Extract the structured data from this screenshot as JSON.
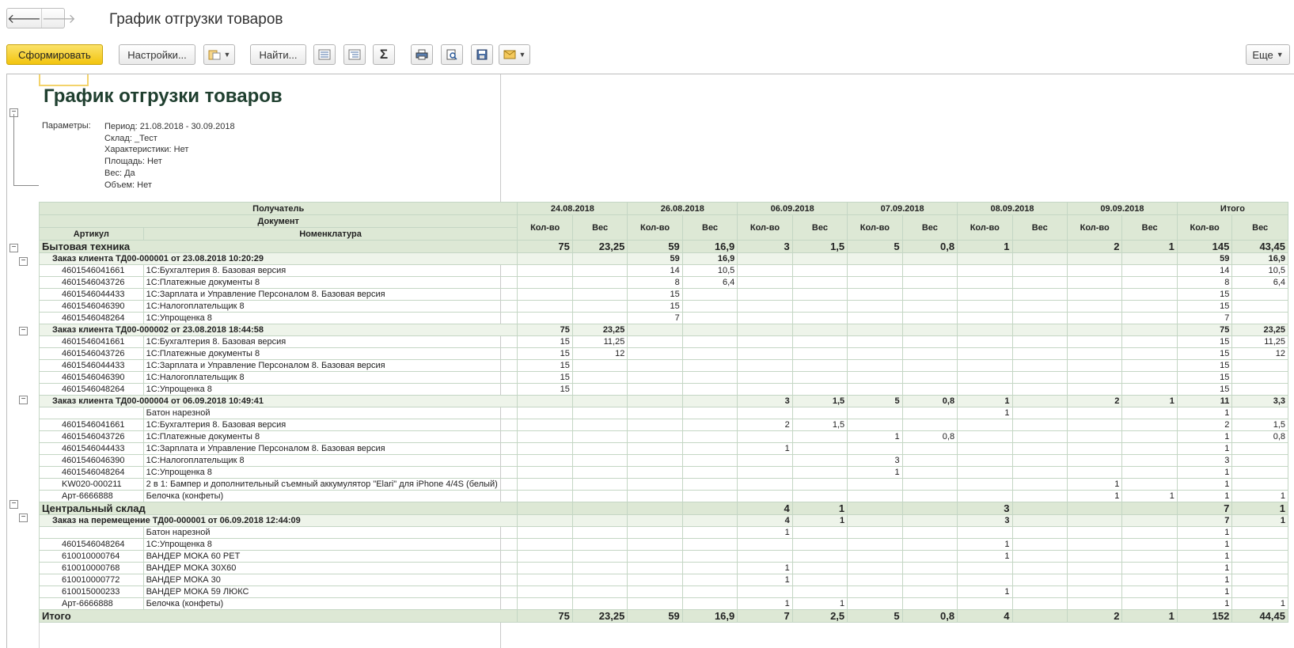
{
  "window": {
    "title": "График отгрузки товаров"
  },
  "nav": {
    "back_icon": "arrow-left-icon",
    "forward_icon": "arrow-right-icon"
  },
  "toolbar": {
    "generate": "Сформировать",
    "settings": "Настройки...",
    "find": "Найти...",
    "more": "Еще"
  },
  "report": {
    "title": "График отгрузки товаров",
    "params_label": "Параметры:",
    "params": [
      "Период: 21.08.2018 - 30.09.2018",
      "Склад: _Тест",
      "Характеристики: Нет",
      "Площадь: Нет",
      "Вес: Да",
      "Объем: Нет"
    ],
    "header": {
      "recipient": "Получатель",
      "document": "Документ",
      "article": "Артикул",
      "nomenclature": "Номенклатура",
      "dates": [
        "24.08.2018",
        "26.08.2018",
        "06.09.2018",
        "07.09.2018",
        "08.09.2018",
        "09.09.2018",
        "Итого"
      ],
      "qty": "Кол-во",
      "weight": "Вес"
    },
    "rows": [
      {
        "level": 1,
        "name": "Бытовая техника",
        "v": [
          "75",
          "23,25",
          "59",
          "16,9",
          "3",
          "1,5",
          "5",
          "0,8",
          "1",
          "",
          "2",
          "1",
          "145",
          "43,45"
        ]
      },
      {
        "level": 2,
        "name": "Заказ клиента ТД00-000001 от 23.08.2018 10:20:29",
        "v": [
          "",
          "",
          "59",
          "16,9",
          "",
          "",
          "",
          "",
          "",
          "",
          "",
          "",
          "59",
          "16,9"
        ]
      },
      {
        "level": 3,
        "art": "4601546041661",
        "name": "1С:Бухгалтерия 8. Базовая версия",
        "v": [
          "",
          "",
          "14",
          "10,5",
          "",
          "",
          "",
          "",
          "",
          "",
          "",
          "",
          "14",
          "10,5"
        ]
      },
      {
        "level": 3,
        "art": "4601546043726",
        "name": "1С:Платежные документы 8",
        "v": [
          "",
          "",
          "8",
          "6,4",
          "",
          "",
          "",
          "",
          "",
          "",
          "",
          "",
          "8",
          "6,4"
        ]
      },
      {
        "level": 3,
        "art": "4601546044433",
        "name": "1С:Зарплата и Управление Персоналом 8. Базовая версия",
        "v": [
          "",
          "",
          "15",
          "",
          "",
          "",
          "",
          "",
          "",
          "",
          "",
          "",
          "15",
          ""
        ]
      },
      {
        "level": 3,
        "art": "4601546046390",
        "name": "1С:Налогоплательщик 8",
        "v": [
          "",
          "",
          "15",
          "",
          "",
          "",
          "",
          "",
          "",
          "",
          "",
          "",
          "15",
          ""
        ]
      },
      {
        "level": 3,
        "art": "4601546048264",
        "name": "1С:Упрощенка 8",
        "v": [
          "",
          "",
          "7",
          "",
          "",
          "",
          "",
          "",
          "",
          "",
          "",
          "",
          "7",
          ""
        ]
      },
      {
        "level": 2,
        "name": "Заказ клиента ТД00-000002 от 23.08.2018 18:44:58",
        "v": [
          "75",
          "23,25",
          "",
          "",
          "",
          "",
          "",
          "",
          "",
          "",
          "",
          "",
          "75",
          "23,25"
        ]
      },
      {
        "level": 3,
        "art": "4601546041661",
        "name": "1С:Бухгалтерия 8. Базовая версия",
        "v": [
          "15",
          "11,25",
          "",
          "",
          "",
          "",
          "",
          "",
          "",
          "",
          "",
          "",
          "15",
          "11,25"
        ]
      },
      {
        "level": 3,
        "art": "4601546043726",
        "name": "1С:Платежные документы 8",
        "v": [
          "15",
          "12",
          "",
          "",
          "",
          "",
          "",
          "",
          "",
          "",
          "",
          "",
          "15",
          "12"
        ]
      },
      {
        "level": 3,
        "art": "4601546044433",
        "name": "1С:Зарплата и Управление Персоналом 8. Базовая версия",
        "v": [
          "15",
          "",
          "",
          "",
          "",
          "",
          "",
          "",
          "",
          "",
          "",
          "",
          "15",
          ""
        ]
      },
      {
        "level": 3,
        "art": "4601546046390",
        "name": "1С:Налогоплательщик 8",
        "v": [
          "15",
          "",
          "",
          "",
          "",
          "",
          "",
          "",
          "",
          "",
          "",
          "",
          "15",
          ""
        ]
      },
      {
        "level": 3,
        "art": "4601546048264",
        "name": "1С:Упрощенка 8",
        "v": [
          "15",
          "",
          "",
          "",
          "",
          "",
          "",
          "",
          "",
          "",
          "",
          "",
          "15",
          ""
        ]
      },
      {
        "level": 2,
        "name": "Заказ клиента ТД00-000004 от 06.09.2018 10:49:41",
        "v": [
          "",
          "",
          "",
          "",
          "3",
          "1,5",
          "5",
          "0,8",
          "1",
          "",
          "2",
          "1",
          "11",
          "3,3"
        ]
      },
      {
        "level": 3,
        "art": "",
        "name": "Батон нарезной",
        "v": [
          "",
          "",
          "",
          "",
          "",
          "",
          "",
          "",
          "1",
          "",
          "",
          "",
          "1",
          ""
        ]
      },
      {
        "level": 3,
        "art": "4601546041661",
        "name": "1С:Бухгалтерия 8. Базовая версия",
        "v": [
          "",
          "",
          "",
          "",
          "2",
          "1,5",
          "",
          "",
          "",
          "",
          "",
          "",
          "2",
          "1,5"
        ]
      },
      {
        "level": 3,
        "art": "4601546043726",
        "name": "1С:Платежные документы 8",
        "v": [
          "",
          "",
          "",
          "",
          "",
          "",
          "1",
          "0,8",
          "",
          "",
          "",
          "",
          "1",
          "0,8"
        ]
      },
      {
        "level": 3,
        "art": "4601546044433",
        "name": "1С:Зарплата и Управление Персоналом 8. Базовая версия",
        "v": [
          "",
          "",
          "",
          "",
          "1",
          "",
          "",
          "",
          "",
          "",
          "",
          "",
          "1",
          ""
        ]
      },
      {
        "level": 3,
        "art": "4601546046390",
        "name": "1С:Налогоплательщик 8",
        "v": [
          "",
          "",
          "",
          "",
          "",
          "",
          "3",
          "",
          "",
          "",
          "",
          "",
          "3",
          ""
        ]
      },
      {
        "level": 3,
        "art": "4601546048264",
        "name": "1С:Упрощенка 8",
        "v": [
          "",
          "",
          "",
          "",
          "",
          "",
          "1",
          "",
          "",
          "",
          "",
          "",
          "1",
          ""
        ]
      },
      {
        "level": 3,
        "art": "KW020-000211",
        "name": "2 в 1: Бампер и дополнительный съемный аккумулятор \"Elari\" для iPhone 4/4S (белый)",
        "v": [
          "",
          "",
          "",
          "",
          "",
          "",
          "",
          "",
          "",
          "",
          "1",
          "",
          "1",
          ""
        ]
      },
      {
        "level": 3,
        "art": "Арт-6666888",
        "name": "Белочка (конфеты)",
        "v": [
          "",
          "",
          "",
          "",
          "",
          "",
          "",
          "",
          "",
          "",
          "1",
          "1",
          "1",
          "1"
        ]
      },
      {
        "level": 1,
        "name": "Центральный склад",
        "v": [
          "",
          "",
          "",
          "",
          "4",
          "1",
          "",
          "",
          "3",
          "",
          "",
          "",
          "7",
          "1"
        ]
      },
      {
        "level": 2,
        "name": "Заказ на перемещение ТД00-000001 от 06.09.2018 12:44:09",
        "v": [
          "",
          "",
          "",
          "",
          "4",
          "1",
          "",
          "",
          "3",
          "",
          "",
          "",
          "7",
          "1"
        ]
      },
      {
        "level": 3,
        "art": "",
        "name": "Батон нарезной",
        "v": [
          "",
          "",
          "",
          "",
          "1",
          "",
          "",
          "",
          "",
          "",
          "",
          "",
          "1",
          ""
        ]
      },
      {
        "level": 3,
        "art": "4601546048264",
        "name": "1С:Упрощенка 8",
        "v": [
          "",
          "",
          "",
          "",
          "",
          "",
          "",
          "",
          "1",
          "",
          "",
          "",
          "1",
          ""
        ]
      },
      {
        "level": 3,
        "art": "610010000764",
        "name": "ВАНДЕР МОКА 60 РЕТ",
        "v": [
          "",
          "",
          "",
          "",
          "",
          "",
          "",
          "",
          "1",
          "",
          "",
          "",
          "1",
          ""
        ]
      },
      {
        "level": 3,
        "art": "610010000768",
        "name": "ВАНДЕР МОКА 30Х60",
        "v": [
          "",
          "",
          "",
          "",
          "1",
          "",
          "",
          "",
          "",
          "",
          "",
          "",
          "1",
          ""
        ]
      },
      {
        "level": 3,
        "art": "610010000772",
        "name": "ВАНДЕР МОКА 30",
        "v": [
          "",
          "",
          "",
          "",
          "1",
          "",
          "",
          "",
          "",
          "",
          "",
          "",
          "1",
          ""
        ]
      },
      {
        "level": 3,
        "art": "610015000233",
        "name": "ВАНДЕР МОКА 59 ЛЮКС",
        "v": [
          "",
          "",
          "",
          "",
          "",
          "",
          "",
          "",
          "1",
          "",
          "",
          "",
          "1",
          ""
        ]
      },
      {
        "level": 3,
        "art": "Арт-6666888",
        "name": "Белочка (конфеты)",
        "v": [
          "",
          "",
          "",
          "",
          "1",
          "1",
          "",
          "",
          "",
          "",
          "",
          "",
          "1",
          "1"
        ]
      }
    ],
    "total": {
      "name": "Итого",
      "v": [
        "75",
        "23,25",
        "59",
        "16,9",
        "7",
        "2,5",
        "5",
        "0,8",
        "4",
        "",
        "2",
        "1",
        "152",
        "44,45"
      ]
    }
  }
}
